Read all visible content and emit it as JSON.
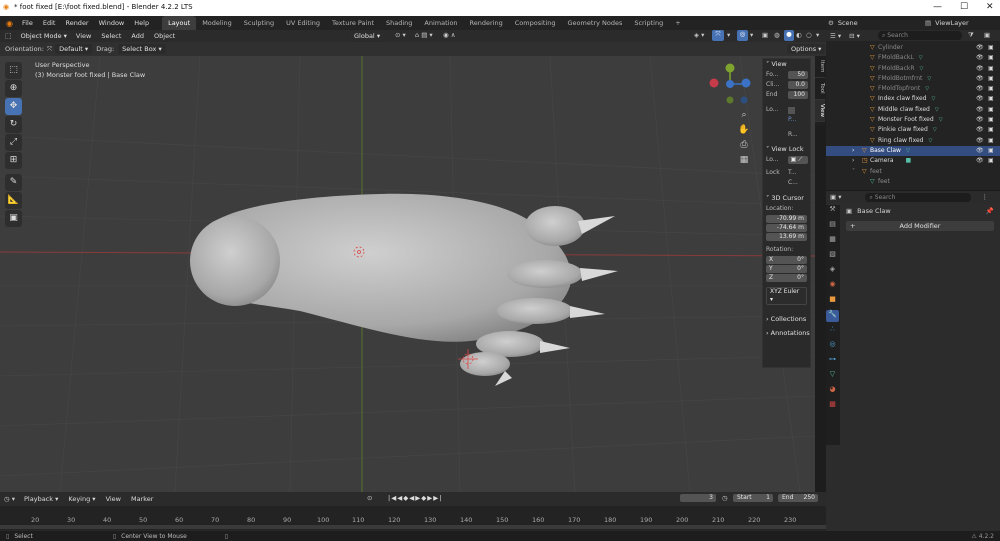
{
  "window": {
    "title": "* foot fixed [E:\\foot fixed.blend] - Blender 4.2.2 LTS"
  },
  "menu": [
    "File",
    "Edit",
    "Render",
    "Window",
    "Help"
  ],
  "workspaces": [
    "Layout",
    "Modeling",
    "Sculpting",
    "UV Editing",
    "Texture Paint",
    "Shading",
    "Animation",
    "Rendering",
    "Compositing",
    "Geometry Nodes",
    "Scripting"
  ],
  "active_workspace": "Layout",
  "scene": "Scene",
  "view_layer": "ViewLayer",
  "header": {
    "mode": "Object Mode",
    "view": "View",
    "select": "Select",
    "add": "Add",
    "object": "Object",
    "transform": "Global",
    "options": "Options"
  },
  "toolsettings": {
    "orientation_label": "Orientation:",
    "orientation": "Default",
    "drag_label": "Drag:",
    "drag": "Select Box"
  },
  "viewport": {
    "perspective": "User Perspective",
    "active": "(3) Monster foot fixed | Base Claw"
  },
  "npanel": {
    "tabs": [
      "Item",
      "Tool",
      "View"
    ],
    "view_title": "View",
    "focal_label": "Fo...",
    "focal": "50",
    "clip_label": "Cli...",
    "clip": "0.0",
    "end_label": "End",
    "end": "100",
    "local_label": "Lo...",
    "p_label": "P...",
    "r_label": "R...",
    "viewlock_title": "View Lock",
    "lock_to_label": "Lo...",
    "lock_label": "Lock",
    "t_label": "T...",
    "c_label": "C...",
    "cursor_title": "3D Cursor",
    "location_label": "Location:",
    "loc_x": "-70.99 m",
    "loc_y": "-74.64 m",
    "loc_z": "13.69 m",
    "rotation_label": "Rotation:",
    "rot_x": "0°",
    "rot_y": "0°",
    "rot_z": "0°",
    "axis_x": "X",
    "axis_y": "Y",
    "axis_z": "Z",
    "euler": "XYZ Euler",
    "collections": "Collections",
    "annotations": "Annotations"
  },
  "outliner": {
    "search_placeholder": "Search",
    "items": [
      {
        "name": "Cylinder",
        "dim": true
      },
      {
        "name": "FMoldBackL",
        "dim": true
      },
      {
        "name": "FMoldBackR",
        "dim": true
      },
      {
        "name": "FMoldBotmfrnt",
        "dim": true
      },
      {
        "name": "FMoldTopfront",
        "dim": true
      },
      {
        "name": "Index claw fixed",
        "dim": false
      },
      {
        "name": "Middle claw fixed",
        "dim": false
      },
      {
        "name": "Monster Foot fixed",
        "dim": false
      },
      {
        "name": "Pinkie claw fixed",
        "dim": false
      },
      {
        "name": "Ring claw fixed",
        "dim": false
      },
      {
        "name": "Base Claw",
        "dim": false,
        "selected": true
      },
      {
        "name": "Camera",
        "dim": false
      },
      {
        "name": "feet",
        "dim": true
      },
      {
        "name": "feet",
        "dim": true
      }
    ]
  },
  "properties": {
    "search_placeholder": "Search",
    "object": "Base Claw",
    "add_modifier": "Add Modifier"
  },
  "timeline": {
    "playback": "Playback",
    "keying": "Keying",
    "view": "View",
    "marker": "Marker",
    "frame": "3",
    "start_label": "Start",
    "start": "1",
    "end_label": "End",
    "end": "250",
    "ticks": [
      "20",
      "30",
      "40",
      "50",
      "60",
      "70",
      "80",
      "90",
      "100",
      "110",
      "120",
      "130",
      "140",
      "150",
      "160",
      "170",
      "180",
      "190",
      "200",
      "210",
      "220",
      "230"
    ]
  },
  "status": {
    "select": "Select",
    "center": "Center View to Mouse",
    "version": "4.2.2"
  }
}
